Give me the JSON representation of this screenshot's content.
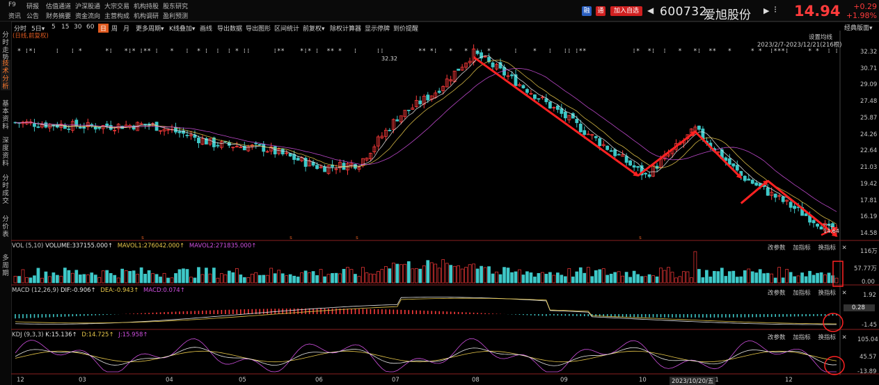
{
  "header": {
    "menu_row1": [
      "F9",
      "研报",
      "估值通道",
      "沪深股通",
      "大宗交易",
      "机构持股",
      "股东研究"
    ],
    "menu_row2": [
      "资讯",
      "公告",
      "财务摘要",
      "资金流向",
      "主营构成",
      "机构调研",
      "盈利预测"
    ],
    "tag_rong": "融",
    "tag_tong": "通",
    "add_watch": "加入自选",
    "code": "600732",
    "name": "爱旭股份",
    "price": "14.94",
    "change": "+0.29",
    "change_pct": "+1.98%"
  },
  "left_tabs": [
    {
      "label": "分时走势",
      "active": false
    },
    {
      "label": "技术分析",
      "active": true
    },
    {
      "label": "基本资料",
      "active": false
    },
    {
      "label": "深度资料",
      "active": false
    },
    {
      "label": "分时成交",
      "active": false
    },
    {
      "label": "分价表",
      "active": false
    },
    {
      "label": "多周期",
      "active": false
    }
  ],
  "toolbar": {
    "items": [
      "分时",
      "5日▾",
      "5",
      "15",
      "30",
      "60",
      "日",
      "周",
      "月",
      "更多周期▾",
      "K线叠加▾",
      "画线",
      "导出数据",
      "导出图形",
      "区间统计",
      "前复权▾",
      "除权计算器",
      "显示停牌",
      "到价提醒"
    ],
    "active": "日",
    "right": "经典版面▾"
  },
  "main_chart": {
    "subtitle": "(日线,前复权)",
    "settings": "设置均线",
    "range": "2023/2/7-2023/12/21(216根)",
    "high_label": "32.32",
    "low_label": "14.64",
    "y_ticks": [
      "32.32",
      "30.71",
      "29.09",
      "27.48",
      "25.87",
      "24.26",
      "22.64",
      "21.03",
      "19.42",
      "17.81",
      "16.19",
      "14.58"
    ]
  },
  "vol_panel": {
    "title": "VOL (5,10)",
    "volume": "VOLUME:337155.000↑",
    "mavol1": "MAVOL1:276042.000↑",
    "mavol2": "MAVOL2:271835.000↑",
    "y_ticks": [
      "116万",
      "57.77万",
      "0.00"
    ],
    "buttons": [
      "改参数",
      "加指标",
      "换指标"
    ]
  },
  "macd_panel": {
    "title": "MACD (12,26,9)",
    "dif": "DIF:-0.906↑",
    "dea": "DEA:-0.943↑",
    "macd": "MACD:0.074↑",
    "y_ticks": [
      "1.92",
      "0.28",
      "-1.45"
    ],
    "buttons": [
      "改参数",
      "加指标",
      "换指标"
    ]
  },
  "kdj_panel": {
    "title": "KDJ (9,3,3)",
    "k": "K:15.136↑",
    "d": "D:14.725↑",
    "j": "J:15.958↑",
    "y_ticks": [
      "105.04",
      "45.57",
      "-13.89"
    ],
    "buttons": [
      "改参数",
      "加指标",
      "换指标"
    ]
  },
  "x_axis": {
    "months": [
      "12",
      "03",
      "04",
      "05",
      "06",
      "07",
      "08",
      "09",
      "10",
      "11",
      "12"
    ],
    "cursor_date": "2023/10/20/五"
  },
  "colors": {
    "up": "#ff3b3b",
    "down": "#3ec8c8",
    "ma_white": "#e8e8e8",
    "ma_yellow": "#e8c84a",
    "ma_purple": "#d050e0",
    "arrow": "#ff2222",
    "accent": "#e05a20"
  },
  "chart_data": {
    "type": "candlestick",
    "title": "600732 爱旭股份",
    "price_path": [
      {
        "x": 0,
        "y": 25.5
      },
      {
        "x": 20,
        "y": 25.1
      },
      {
        "x": 35,
        "y": 25.3
      },
      {
        "x": 45,
        "y": 24.3
      },
      {
        "x": 52,
        "y": 23.4
      },
      {
        "x": 65,
        "y": 23.0
      },
      {
        "x": 80,
        "y": 21.1
      },
      {
        "x": 90,
        "y": 21.5
      },
      {
        "x": 100,
        "y": 26.0
      },
      {
        "x": 110,
        "y": 28.5
      },
      {
        "x": 120,
        "y": 32.3
      },
      {
        "x": 135,
        "y": 28.5
      },
      {
        "x": 165,
        "y": 20.3
      },
      {
        "x": 178,
        "y": 24.8
      },
      {
        "x": 190,
        "y": 20.3
      },
      {
        "x": 215,
        "y": 14.6
      }
    ]
  }
}
